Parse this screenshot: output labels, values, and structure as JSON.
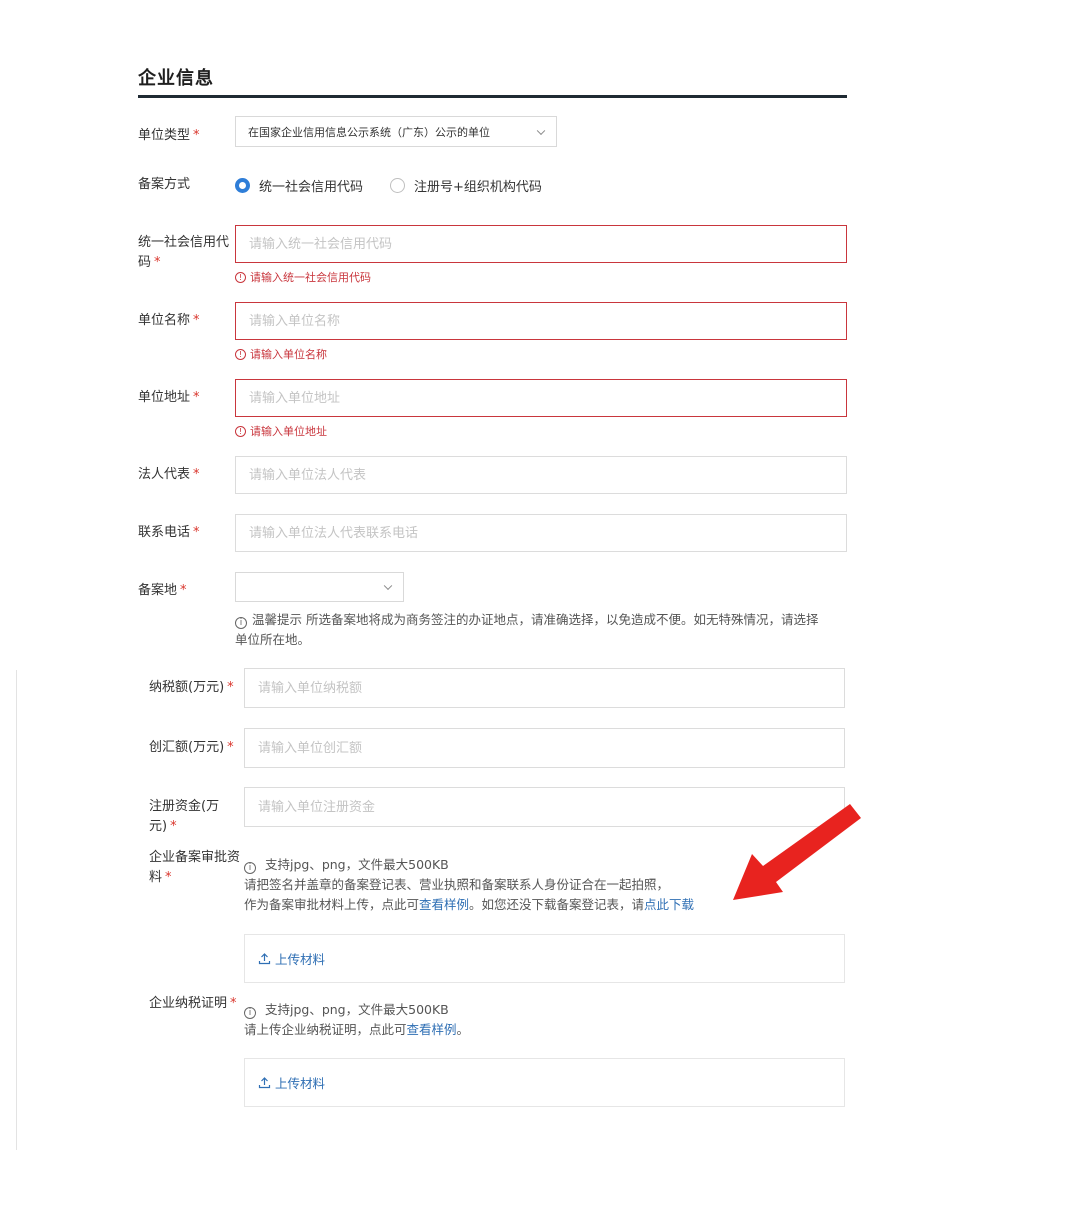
{
  "section": {
    "title": "企业信息"
  },
  "required_mark": "*",
  "unit_type": {
    "label": "单位类型",
    "value": "在国家企业信用信息公示系统（广东）公示的单位"
  },
  "filing_method": {
    "label": "备案方式",
    "options": [
      {
        "label": "统一社会信用代码",
        "checked": true
      },
      {
        "label": "注册号+组织机构代码",
        "checked": false
      }
    ]
  },
  "credit_code": {
    "label_line1": "统一社会信用代",
    "label_line2": "码",
    "placeholder": "请输入统一社会信用代码",
    "error": "请输入统一社会信用代码"
  },
  "unit_name": {
    "label": "单位名称",
    "placeholder": "请输入单位名称",
    "error": "请输入单位名称"
  },
  "unit_address": {
    "label": "单位地址",
    "placeholder": "请输入单位地址",
    "error": "请输入单位地址"
  },
  "legal_rep": {
    "label": "法人代表",
    "placeholder": "请输入单位法人代表"
  },
  "phone": {
    "label": "联系电话",
    "placeholder": "请输入单位法人代表联系电话"
  },
  "filing_place": {
    "label": "备案地",
    "value": "",
    "hint_line1": "温馨提示 所选备案地将成为商务签注的办证地点，请准确选择，以免造成不便。如无特殊情况，请选择",
    "hint_line2": "单位所在地。"
  },
  "tax_amount": {
    "label": "纳税额(万元)",
    "placeholder": "请输入单位纳税额"
  },
  "forex_amount": {
    "label": "创汇额(万元)",
    "placeholder": "请输入单位创汇额"
  },
  "reg_capital": {
    "label_line1": "注册资金(万",
    "label_line2": "元)",
    "placeholder": "请输入单位注册资金"
  },
  "approval_docs": {
    "label_line1": "企业备案审批资",
    "label_line2": "料",
    "support": "支持jpg、png，文件最大500KB",
    "desc_line1": "请把签名并盖章的备案登记表、营业执照和备案联系人身份证合在一起拍照，",
    "desc_line2_a": "作为备案审批材料上传，点此可",
    "view_sample": "查看样例",
    "desc_line2_b": "。如您还没下载备案登记表，请",
    "download_link": "点此下载",
    "upload": "上传材料"
  },
  "tax_proof": {
    "label": "企业纳税证明",
    "support": "支持jpg、png，文件最大500KB",
    "desc_a": "请上传企业纳税证明，点此可",
    "view_sample": "查看样例",
    "desc_b": "。",
    "upload": "上传材料"
  },
  "colors": {
    "accent": "#2f7ed8",
    "error": "#c9363d",
    "required": "#d9342b",
    "annotation_arrow": "#e8231f"
  }
}
